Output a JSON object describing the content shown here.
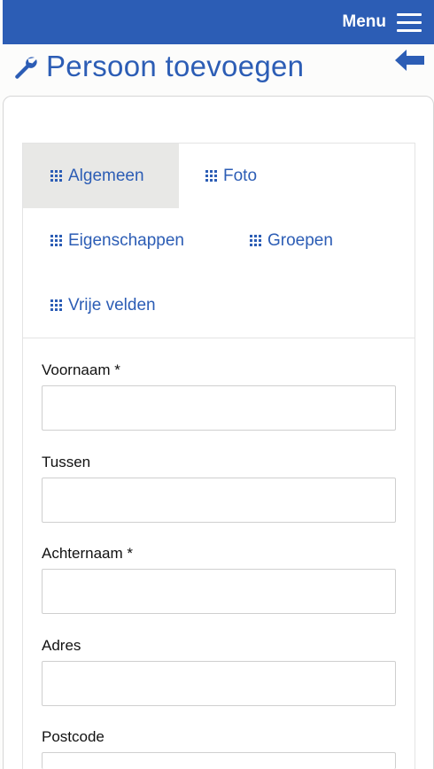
{
  "header": {
    "menu_label": "Menu"
  },
  "page": {
    "title": "Persoon toevoegen"
  },
  "tabs": [
    {
      "label": "Algemeen",
      "active": true
    },
    {
      "label": "Foto",
      "active": false
    },
    {
      "label": "Eigenschappen",
      "active": false
    },
    {
      "label": "Groepen",
      "active": false
    },
    {
      "label": "Vrije velden",
      "active": false
    }
  ],
  "form": {
    "fields": [
      {
        "label": "Voornaam *",
        "value": ""
      },
      {
        "label": "Tussen",
        "value": ""
      },
      {
        "label": "Achternaam *",
        "value": ""
      },
      {
        "label": "Adres",
        "value": ""
      },
      {
        "label": "Postcode",
        "value": ""
      }
    ]
  },
  "colors": {
    "accent": "#2c5db5",
    "active_tab_bg": "#e8e8e6"
  },
  "icons": {
    "menu": "hamburger-icon",
    "title": "wrench-icon",
    "back": "arrow-left-icon",
    "tab": "grid-dots-icon"
  }
}
